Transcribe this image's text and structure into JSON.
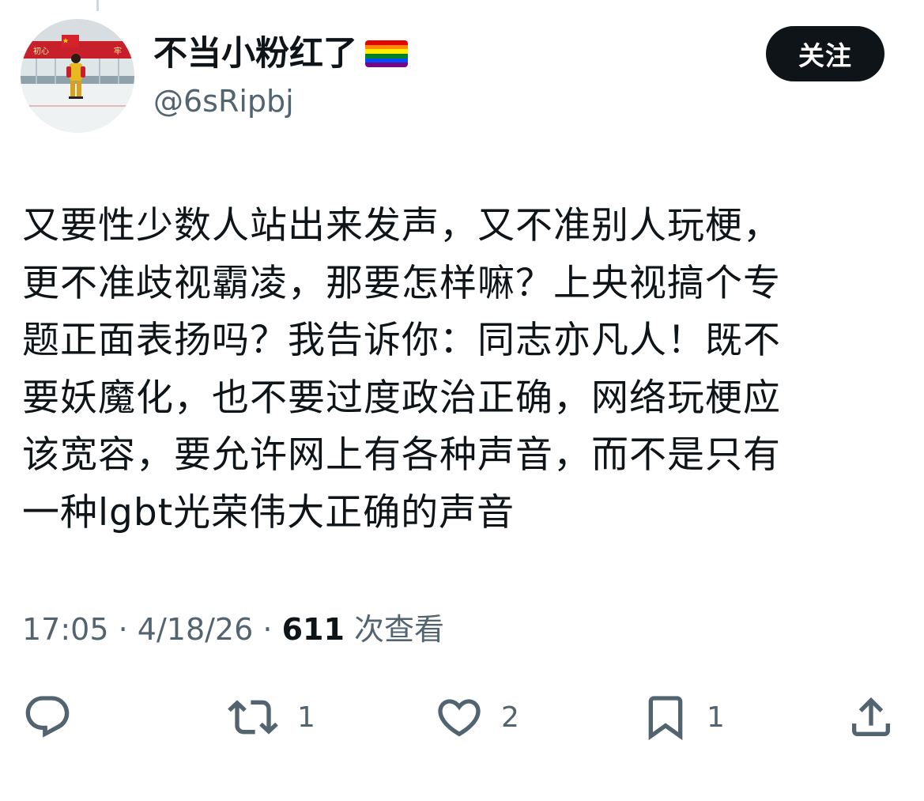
{
  "author": {
    "display_name": "不当小粉红了",
    "handle": "@6sRipbj",
    "avatar_banner_texts": [
      "初心",
      "牢"
    ]
  },
  "follow_button": {
    "label": "关注"
  },
  "tweet": {
    "text_lines": [
      "又要性少数人站出来发声，又不准别人玩梗，",
      "更不准歧视霸凌，那要怎样嘛？上央视搞个专",
      "题正面表扬吗？我告诉你：同志亦凡人！既不",
      "要妖魔化，也不要过度政治正确，网络玩梗应",
      "该宽容，要允许网上有各种声音，而不是只有",
      "一种lgbt光荣伟大正确的声音"
    ]
  },
  "meta": {
    "time": "17:05",
    "separator": "·",
    "date": "4/18/26",
    "views_count": "611",
    "views_label": "次查看"
  },
  "actions": {
    "reply": {
      "icon": "reply-icon",
      "count": ""
    },
    "repost": {
      "icon": "repost-icon",
      "count": "1"
    },
    "like": {
      "icon": "heart-icon",
      "count": "2"
    },
    "bookmark": {
      "icon": "bookmark-icon",
      "count": "1"
    },
    "share": {
      "icon": "share-icon",
      "count": ""
    }
  },
  "colors": {
    "text_primary": "#0f1419",
    "text_secondary": "#536471",
    "button_bg": "#0f1419",
    "button_text": "#ffffff",
    "flag_stripes": [
      "#e40303",
      "#ff8c00",
      "#ffed00",
      "#008026",
      "#004dff",
      "#750787"
    ]
  }
}
